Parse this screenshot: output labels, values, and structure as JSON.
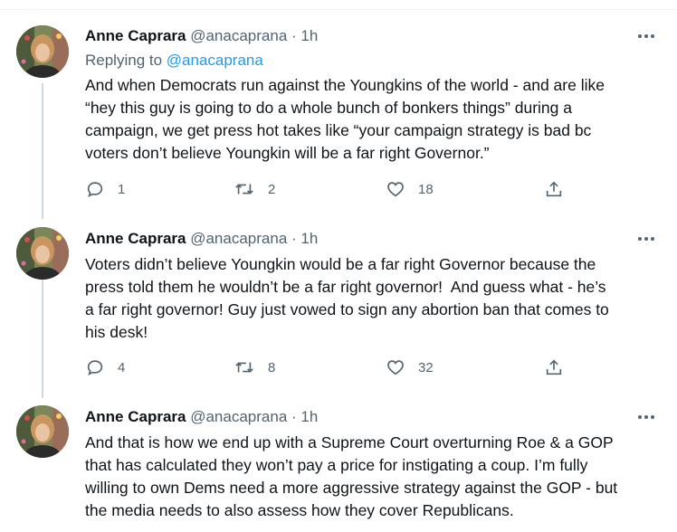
{
  "tweets": [
    {
      "name": "Anne Caprara",
      "handle": "@anacaprana",
      "separator": "·",
      "time": "1h",
      "replying_prefix": "Replying to ",
      "replying_to": "@anacaprana",
      "text": "And when Democrats run against the Youngkins of the world - and are like\n“hey this guy is going to do a whole bunch of bonkers things” during a\ncampaign, we get press hot takes like “your campaign strategy is bad bc\nvoters don’t believe Youngkin will be a far right Governor.”",
      "replies": "1",
      "retweets": "2",
      "likes": "18"
    },
    {
      "name": "Anne Caprara",
      "handle": "@anacaprana",
      "separator": "·",
      "time": "1h",
      "text": "Voters didn’t believe Youngkin would be a far right Governor because the\npress told them he wouldn’t be a far right governor!  And guess what - he’s\na far right governor! Guy just vowed to sign any abortion ban that comes to\nhis desk!",
      "replies": "4",
      "retweets": "8",
      "likes": "32"
    },
    {
      "name": "Anne Caprara",
      "handle": "@anacaprana",
      "separator": "·",
      "time": "1h",
      "text": "And that is how we end up with a Supreme Court overturning Roe & a GOP\nthat has calculated they won’t pay a price for instigating a coup. I’m fully\nwilling to own Dems need a more aggressive strategy against the GOP - but\nthe media needs to also assess how they cover Republicans."
    }
  ],
  "icons": {
    "more": "more-horizontal-icon",
    "reply": "reply-bubble-icon",
    "retweet": "retweet-icon",
    "like": "heart-icon",
    "share": "share-upload-icon"
  },
  "colors": {
    "text": "#0f1419",
    "secondary": "#536471",
    "link": "#1d9bf0",
    "thread_line": "#cfd9de"
  }
}
